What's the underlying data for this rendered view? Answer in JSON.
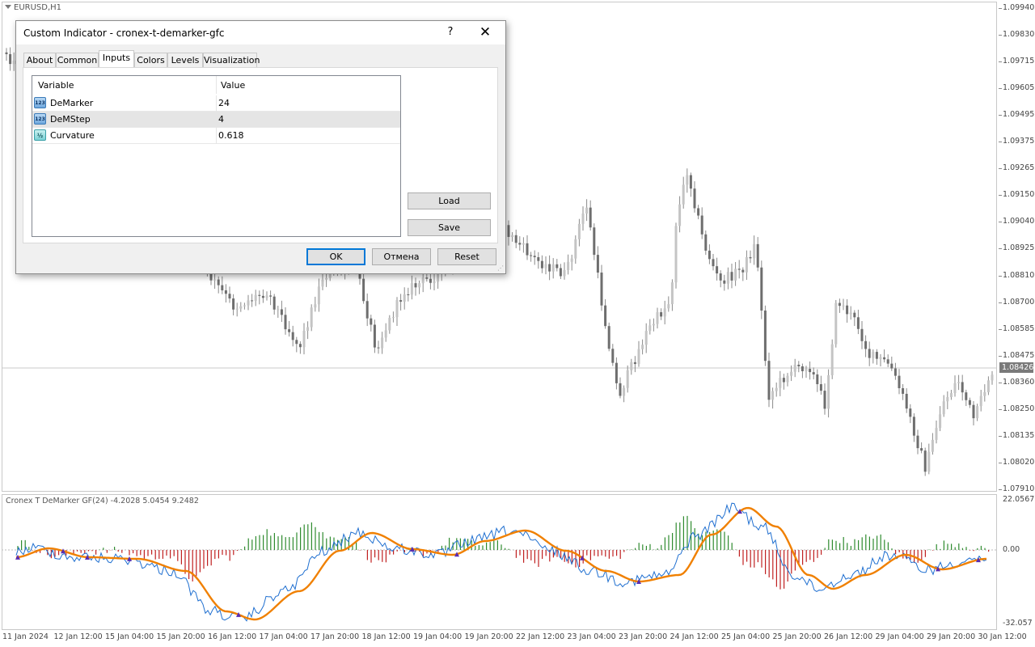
{
  "chart": {
    "symbol_title": "EURUSD,H1",
    "current_price": "1.08426",
    "price_labels": [
      "1.09940",
      "1.09830",
      "1.09715",
      "1.09605",
      "1.09495",
      "1.09375",
      "1.09265",
      "1.09150",
      "1.09040",
      "1.08925",
      "1.08810",
      "1.08700",
      "1.08585",
      "1.08475",
      "1.08360",
      "1.08250",
      "1.08135",
      "1.08020",
      "1.07910"
    ],
    "time_labels": [
      "11 Jan 2024",
      "12 Jan 12:00",
      "15 Jan 04:00",
      "15 Jan 20:00",
      "16 Jan 12:00",
      "17 Jan 04:00",
      "17 Jan 20:00",
      "18 Jan 12:00",
      "19 Jan 04:00",
      "19 Jan 20:00",
      "22 Jan 12:00",
      "23 Jan 04:00",
      "23 Jan 20:00",
      "24 Jan 12:00",
      "25 Jan 04:00",
      "25 Jan 20:00",
      "26 Jan 12:00",
      "29 Jan 04:00",
      "29 Jan 20:00",
      "30 Jan 12:00"
    ]
  },
  "indicator": {
    "title": "Cronex T DeMarker GF(24) -4.2028 5.0454 9.2482",
    "axis_labels": [
      "22.0567",
      "0.00",
      "-32.057"
    ],
    "colors": {
      "fast_line": "#1f6fd0",
      "signal_line": "#f08000",
      "hist_up": "#2e8b2e",
      "hist_down": "#c02020"
    }
  },
  "dialog": {
    "title": "Custom Indicator - cronex-t-demarker-gfc",
    "help_label": "?",
    "close_label": "✕",
    "tabs": [
      {
        "label": "About"
      },
      {
        "label": "Common"
      },
      {
        "label": "Inputs"
      },
      {
        "label": "Colors"
      },
      {
        "label": "Levels"
      },
      {
        "label": "Visualization"
      }
    ],
    "active_tab": "Inputs",
    "table": {
      "col_variable": "Variable",
      "col_value": "Value",
      "rows": [
        {
          "icon": "int-icon",
          "icon_text": "123",
          "variable": "DeMarker",
          "value": "24"
        },
        {
          "icon": "int-icon",
          "icon_text": "123",
          "variable": "DeMStep",
          "value": "4"
        },
        {
          "icon": "double-icon",
          "icon_text": "½",
          "variable": "Curvature",
          "value": "0.618"
        }
      ]
    },
    "load_label": "Load",
    "save_label": "Save",
    "ok_label": "OK",
    "cancel_label": "Отмена",
    "reset_label": "Reset"
  }
}
